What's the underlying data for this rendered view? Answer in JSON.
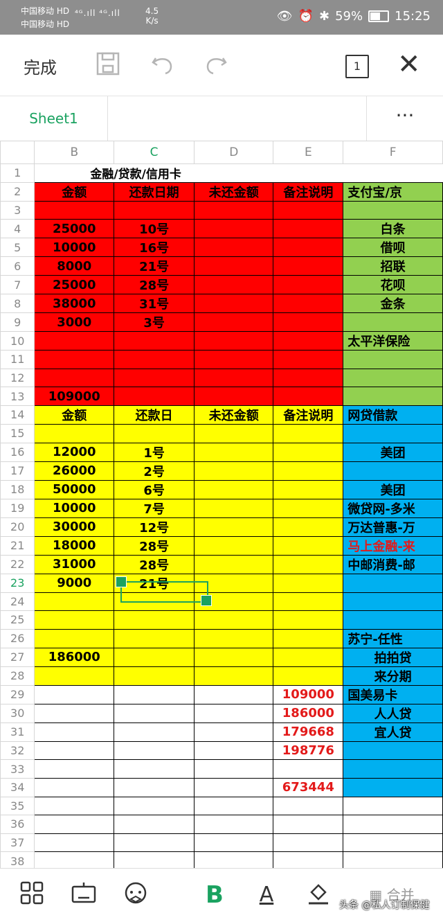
{
  "status_bar": {
    "carrier1": "中国移动 HD",
    "carrier2": "中国移动 HD",
    "signal": "⁴ᴳ.ıll ⁴ᴳ.ıll",
    "speed_value": "4.5",
    "speed_unit": "K/s",
    "battery": "59%",
    "time": "15:25"
  },
  "toolbar": {
    "done_label": "完成",
    "page_count": "1"
  },
  "tabs": {
    "sheet_name": "Sheet1",
    "more": "···"
  },
  "columns": [
    "B",
    "C",
    "D",
    "E",
    "F"
  ],
  "selected_column": "C",
  "selected_row": "23",
  "title": "金融/贷款/信用卡",
  "rows": [
    {
      "n": "1",
      "fill": [
        "wht",
        "wht",
        "wht",
        "wht",
        "wht"
      ],
      "cells": [
        "",
        "",
        "",
        "",
        ""
      ]
    },
    {
      "n": "2",
      "fill": [
        "red",
        "red",
        "red",
        "red",
        "grn"
      ],
      "cells": [
        "金额",
        "还款日期",
        "未还金额",
        "备注说明",
        "支付宝/京"
      ]
    },
    {
      "n": "3",
      "fill": [
        "red",
        "red",
        "red",
        "red",
        "grn"
      ],
      "cells": [
        "",
        "",
        "",
        "",
        ""
      ]
    },
    {
      "n": "4",
      "fill": [
        "red",
        "red",
        "red",
        "red",
        "grn"
      ],
      "cells": [
        "25000",
        "10号",
        "",
        "",
        "白条"
      ]
    },
    {
      "n": "5",
      "fill": [
        "red",
        "red",
        "red",
        "red",
        "grn"
      ],
      "cells": [
        "10000",
        "16号",
        "",
        "",
        "借呗"
      ]
    },
    {
      "n": "6",
      "fill": [
        "red",
        "red",
        "red",
        "red",
        "grn"
      ],
      "cells": [
        "8000",
        "21号",
        "",
        "",
        "招联"
      ]
    },
    {
      "n": "7",
      "fill": [
        "red",
        "red",
        "red",
        "red",
        "grn"
      ],
      "cells": [
        "25000",
        "28号",
        "",
        "",
        "花呗"
      ]
    },
    {
      "n": "8",
      "fill": [
        "red",
        "red",
        "red",
        "red",
        "grn"
      ],
      "cells": [
        "38000",
        "31号",
        "",
        "",
        "金条"
      ]
    },
    {
      "n": "9",
      "fill": [
        "red",
        "red",
        "red",
        "red",
        "grn"
      ],
      "cells": [
        "3000",
        "3号",
        "",
        "",
        ""
      ]
    },
    {
      "n": "10",
      "fill": [
        "red",
        "red",
        "red",
        "red",
        "grn"
      ],
      "cells": [
        "",
        "",
        "",
        "",
        "太平洋保险"
      ]
    },
    {
      "n": "11",
      "fill": [
        "red",
        "red",
        "red",
        "red",
        "grn"
      ],
      "cells": [
        "",
        "",
        "",
        "",
        ""
      ]
    },
    {
      "n": "12",
      "fill": [
        "red",
        "red",
        "red",
        "red",
        "grn"
      ],
      "cells": [
        "",
        "",
        "",
        "",
        ""
      ]
    },
    {
      "n": "13",
      "fill": [
        "red",
        "red",
        "red",
        "red",
        "grn"
      ],
      "cells": [
        "109000",
        "",
        "",
        "",
        ""
      ]
    },
    {
      "n": "14",
      "fill": [
        "yel",
        "yel",
        "yel",
        "yel",
        "blu"
      ],
      "cells": [
        "金额",
        "还款日",
        "未还金额",
        "备注说明",
        "网贷借款"
      ]
    },
    {
      "n": "15",
      "fill": [
        "yel",
        "yel",
        "yel",
        "yel",
        "blu"
      ],
      "cells": [
        "",
        "",
        "",
        "",
        ""
      ]
    },
    {
      "n": "16",
      "fill": [
        "yel",
        "yel",
        "yel",
        "yel",
        "blu"
      ],
      "cells": [
        "12000",
        "1号",
        "",
        "",
        "美团"
      ]
    },
    {
      "n": "17",
      "fill": [
        "yel",
        "yel",
        "yel",
        "yel",
        "blu"
      ],
      "cells": [
        "26000",
        "2号",
        "",
        "",
        ""
      ]
    },
    {
      "n": "18",
      "fill": [
        "yel",
        "yel",
        "yel",
        "yel",
        "blu"
      ],
      "cells": [
        "50000",
        "6号",
        "",
        "",
        "美团"
      ]
    },
    {
      "n": "19",
      "fill": [
        "yel",
        "yel",
        "yel",
        "yel",
        "blu"
      ],
      "cells": [
        "10000",
        "7号",
        "",
        "",
        "微贷网-多米"
      ]
    },
    {
      "n": "20",
      "fill": [
        "yel",
        "yel",
        "yel",
        "yel",
        "blu"
      ],
      "cells": [
        "30000",
        "12号",
        "",
        "",
        "万达普惠-万"
      ]
    },
    {
      "n": "21",
      "fill": [
        "yel",
        "yel",
        "yel",
        "yel",
        "blu"
      ],
      "cells": [
        "18000",
        "28号",
        "",
        "",
        "马上金融-来"
      ],
      "red_text": [
        4
      ]
    },
    {
      "n": "22",
      "fill": [
        "yel",
        "yel",
        "yel",
        "yel",
        "blu"
      ],
      "cells": [
        "31000",
        "28号",
        "",
        "",
        "中邮消费-邮"
      ]
    },
    {
      "n": "23",
      "fill": [
        "yel",
        "yel",
        "yel",
        "yel",
        "blu"
      ],
      "cells": [
        "9000",
        "21号",
        "",
        "",
        ""
      ]
    },
    {
      "n": "24",
      "fill": [
        "yel",
        "yel",
        "yel",
        "yel",
        "blu"
      ],
      "cells": [
        "",
        "",
        "",
        "",
        ""
      ]
    },
    {
      "n": "25",
      "fill": [
        "yel",
        "yel",
        "yel",
        "yel",
        "blu"
      ],
      "cells": [
        "",
        "",
        "",
        "",
        ""
      ]
    },
    {
      "n": "26",
      "fill": [
        "yel",
        "yel",
        "yel",
        "yel",
        "blu"
      ],
      "cells": [
        "",
        "",
        "",
        "",
        "苏宁-任性"
      ]
    },
    {
      "n": "27",
      "fill": [
        "yel",
        "yel",
        "yel",
        "yel",
        "blu"
      ],
      "cells": [
        "186000",
        "",
        "",
        "",
        "拍拍贷"
      ]
    },
    {
      "n": "28",
      "fill": [
        "yel",
        "yel",
        "yel",
        "yel",
        "blu"
      ],
      "cells": [
        "",
        "",
        "",
        "",
        "来分期"
      ]
    },
    {
      "n": "29",
      "fill": [
        "wht",
        "wht",
        "wht",
        "wht",
        "blu"
      ],
      "cells": [
        "",
        "",
        "",
        "109000",
        "国美易卡"
      ],
      "red_text": [
        3
      ]
    },
    {
      "n": "30",
      "fill": [
        "wht",
        "wht",
        "wht",
        "wht",
        "blu"
      ],
      "cells": [
        "",
        "",
        "",
        "186000",
        "人人贷"
      ],
      "red_text": [
        3
      ]
    },
    {
      "n": "31",
      "fill": [
        "wht",
        "wht",
        "wht",
        "wht",
        "blu"
      ],
      "cells": [
        "",
        "",
        "",
        "179668",
        "宜人贷"
      ],
      "red_text": [
        3
      ]
    },
    {
      "n": "32",
      "fill": [
        "wht",
        "wht",
        "wht",
        "wht",
        "blu"
      ],
      "cells": [
        "",
        "",
        "",
        "198776",
        ""
      ],
      "red_text": [
        3
      ]
    },
    {
      "n": "33",
      "fill": [
        "wht",
        "wht",
        "wht",
        "wht",
        "blu"
      ],
      "cells": [
        "",
        "",
        "",
        "",
        ""
      ]
    },
    {
      "n": "34",
      "fill": [
        "wht",
        "wht",
        "wht",
        "wht",
        "blu"
      ],
      "cells": [
        "",
        "",
        "",
        "673444",
        ""
      ],
      "red_text": [
        3
      ]
    },
    {
      "n": "35",
      "fill": [
        "wht",
        "wht",
        "wht",
        "wht",
        "wht"
      ],
      "cells": [
        "",
        "",
        "",
        "",
        ""
      ]
    },
    {
      "n": "36",
      "fill": [
        "wht",
        "wht",
        "wht",
        "wht",
        "wht"
      ],
      "cells": [
        "",
        "",
        "",
        "",
        ""
      ]
    },
    {
      "n": "37",
      "fill": [
        "wht",
        "wht",
        "wht",
        "wht",
        "wht"
      ],
      "cells": [
        "",
        "",
        "",
        "",
        ""
      ]
    },
    {
      "n": "38",
      "fill": [
        "wht",
        "wht",
        "wht",
        "wht",
        "wht"
      ],
      "cells": [
        "",
        "",
        "",
        "",
        ""
      ]
    }
  ],
  "bottom_bar": {
    "merge_label": "合并",
    "bold_icon": "B",
    "text_color_icon": "A"
  },
  "watermark": "头条 @私人订制保健",
  "colors": {
    "accent": "#1aa260",
    "red_fill": "#ff0000",
    "yellow_fill": "#ffff00",
    "green_fill": "#92d050",
    "blue_fill": "#00b0f0",
    "red_text": "#e31a1a"
  }
}
